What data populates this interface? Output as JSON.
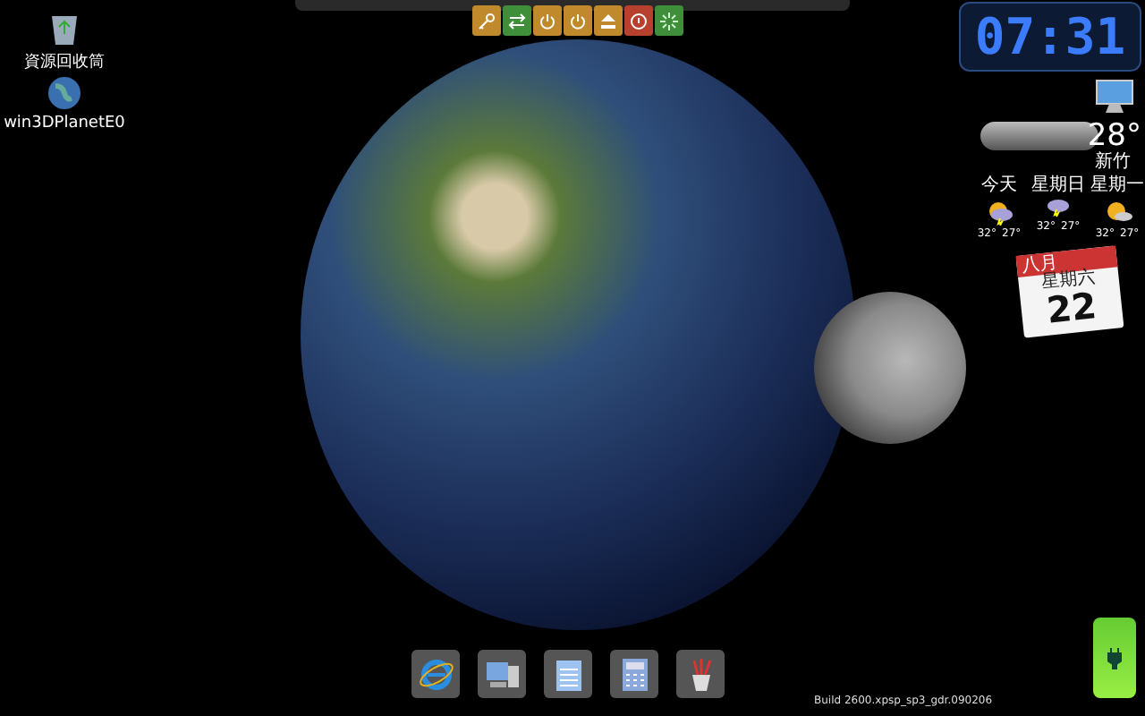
{
  "desktop_icons": [
    {
      "kind": "recycle-bin",
      "label": "資源回收筒"
    },
    {
      "kind": "globe",
      "label": "win3DPlanetE0"
    }
  ],
  "top_toolbar": {
    "buttons": [
      {
        "kind": "key",
        "color": "#c08a2c"
      },
      {
        "kind": "arrows",
        "color": "#3f8f3a"
      },
      {
        "kind": "power",
        "color": "#c08a2c"
      },
      {
        "kind": "power",
        "color": "#c08a2c"
      },
      {
        "kind": "eject",
        "color": "#c08a2c"
      },
      {
        "kind": "stop",
        "color": "#b8402e"
      },
      {
        "kind": "burst",
        "color": "#3f8f3a"
      }
    ]
  },
  "clock": {
    "time": "07:31"
  },
  "weather": {
    "temperature": "28°",
    "city": "新竹",
    "forecast": [
      {
        "day": "今天",
        "high": "32°",
        "low": "27°",
        "kind": "storm-sun"
      },
      {
        "day": "星期日",
        "high": "32°",
        "low": "27°",
        "kind": "storm"
      },
      {
        "day": "星期一",
        "high": "32°",
        "low": "27°",
        "kind": "sun"
      }
    ]
  },
  "calendar": {
    "month": "八月",
    "weekday": "星期六",
    "day": "22"
  },
  "dock": {
    "items": [
      {
        "kind": "browser"
      },
      {
        "kind": "computer"
      },
      {
        "kind": "notepad"
      },
      {
        "kind": "calculator"
      },
      {
        "kind": "paint"
      }
    ]
  },
  "build_text": "Build 2600.xpsp_sp3_gdr.090206"
}
